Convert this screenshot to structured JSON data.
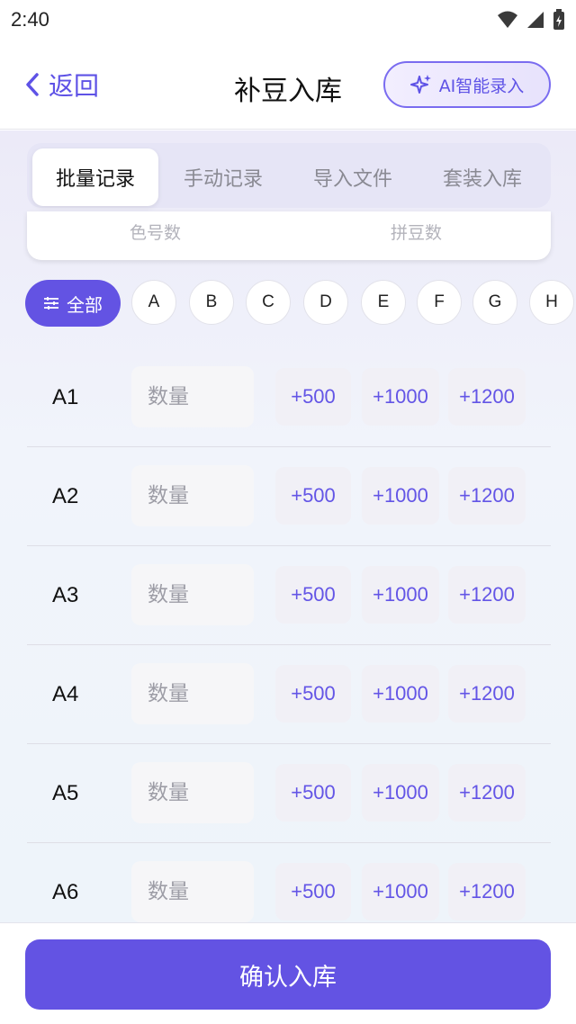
{
  "status_bar": {
    "time": "2:40"
  },
  "header": {
    "back_label": "返回",
    "title": "补豆入库",
    "ai_button_label": "AI智能录入"
  },
  "tabs": [
    {
      "label": "批量记录",
      "active": true
    },
    {
      "label": "手动记录",
      "active": false
    },
    {
      "label": "导入文件",
      "active": false
    },
    {
      "label": "套装入库",
      "active": false
    }
  ],
  "summary": {
    "color_count_label": "色号数",
    "bead_count_label": "拼豆数"
  },
  "filters": {
    "all_label": "全部",
    "letters": [
      "A",
      "B",
      "C",
      "D",
      "E",
      "F",
      "G",
      "H"
    ]
  },
  "rows": [
    {
      "code": "A1",
      "placeholder": "数量",
      "increments": [
        "+500",
        "+1000",
        "+1200"
      ]
    },
    {
      "code": "A2",
      "placeholder": "数量",
      "increments": [
        "+500",
        "+1000",
        "+1200"
      ]
    },
    {
      "code": "A3",
      "placeholder": "数量",
      "increments": [
        "+500",
        "+1000",
        "+1200"
      ]
    },
    {
      "code": "A4",
      "placeholder": "数量",
      "increments": [
        "+500",
        "+1000",
        "+1200"
      ]
    },
    {
      "code": "A5",
      "placeholder": "数量",
      "increments": [
        "+500",
        "+1000",
        "+1200"
      ]
    },
    {
      "code": "A6",
      "placeholder": "数量",
      "increments": [
        "+500",
        "+1000",
        "+1200"
      ]
    }
  ],
  "footer": {
    "confirm_label": "确认入库"
  },
  "colors": {
    "accent": "#6353e3",
    "accent_text": "#5e52e6"
  }
}
